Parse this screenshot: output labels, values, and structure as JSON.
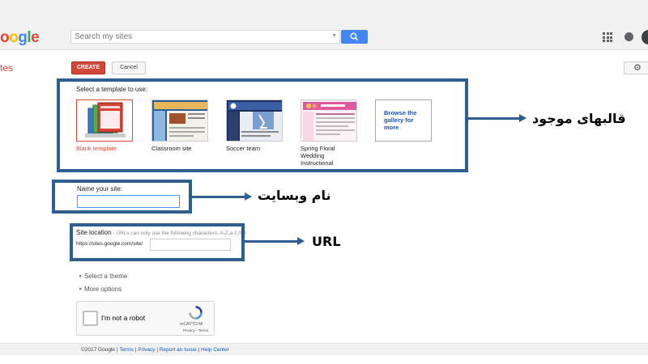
{
  "header": {
    "logo": "oogle",
    "search_placeholder": "Search my sites"
  },
  "toolbar": {
    "sites_label": "tes",
    "create_label": "CREATE",
    "cancel_label": "Cancel"
  },
  "templates": {
    "heading": "Select a template to use:",
    "items": [
      {
        "label": "Blank template"
      },
      {
        "label": "Classroom site"
      },
      {
        "label": "Soccer team"
      },
      {
        "label": "Spring Floral Wedding Instructional"
      }
    ],
    "browse_label": "Browse the gallery for more"
  },
  "name_section": {
    "label": "Name your site:",
    "value": ""
  },
  "location_section": {
    "label": "Site location",
    "hint": " - URLs can only use the following characters: A-Z,a-z,0-9",
    "prefix": "https://sites.google.com/site/",
    "value": ""
  },
  "options": {
    "select_theme": "Select a theme",
    "more_options": "More options"
  },
  "captcha": {
    "label": "I'm not a robot",
    "brand": "reCAPTCHA",
    "privacy": "Privacy",
    "sep": " - ",
    "terms": "Terms"
  },
  "footer": {
    "copyright": "©2017 Google",
    "sep": " | ",
    "terms": "Terms",
    "privacy": "Privacy",
    "report": "Report an Issue",
    "help": "Help Center"
  },
  "annotations": {
    "templates": "قالبهای موجود",
    "site_name": "نام وبسایت",
    "url": "URL"
  },
  "colors": {
    "accent_red": "#d14836",
    "link_blue": "#1155cc",
    "annotation_blue": "#2e5e8e",
    "search_blue": "#4285f4"
  }
}
